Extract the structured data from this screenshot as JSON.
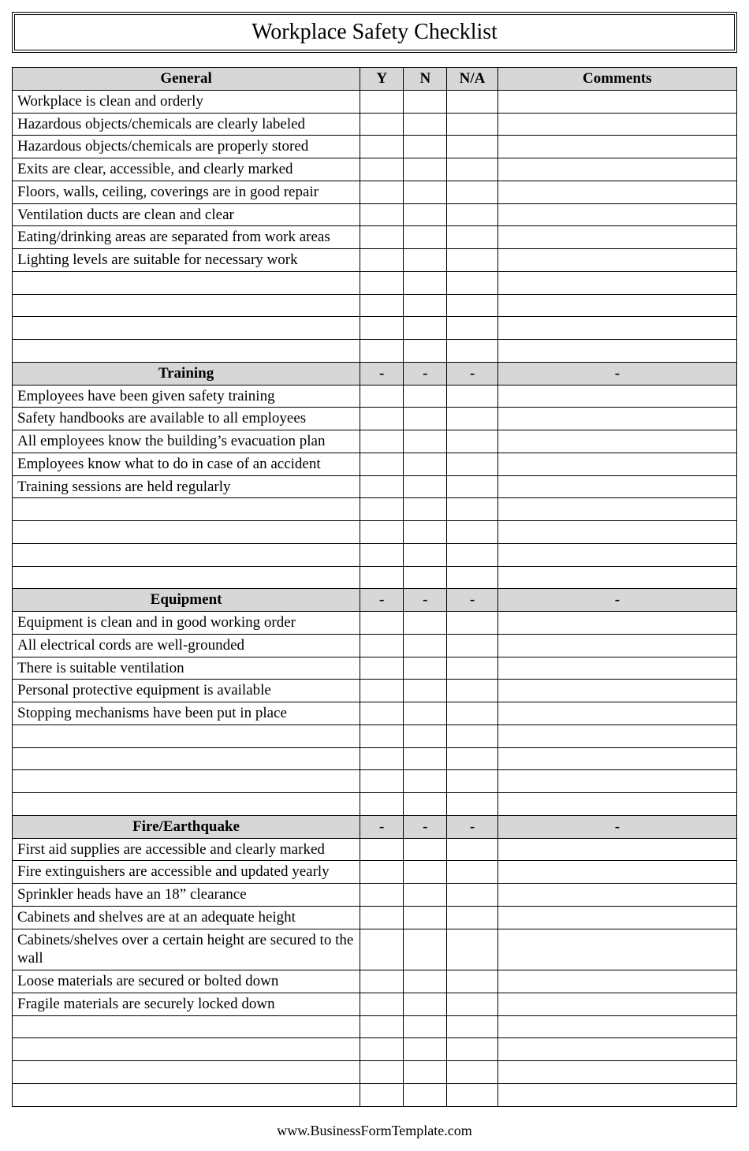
{
  "title": "Workplace Safety Checklist",
  "columns": {
    "y": "Y",
    "n": "N",
    "na": "N/A",
    "comments": "Comments"
  },
  "sections": [
    {
      "name": "General",
      "dash": false,
      "items": [
        "Workplace is clean and orderly",
        "Hazardous objects/chemicals are clearly labeled",
        "Hazardous objects/chemicals are properly stored",
        "Exits are clear, accessible, and clearly marked",
        "Floors, walls, ceiling, coverings are in good repair",
        "Ventilation ducts are clean and clear",
        "Eating/drinking areas are separated from work areas",
        "Lighting levels are suitable for necessary work"
      ],
      "blanks": 4
    },
    {
      "name": "Training",
      "dash": true,
      "items": [
        "Employees have been given safety training",
        "Safety handbooks are available to all employees",
        "All employees know the building’s evacuation plan",
        "Employees know what to do in case of an accident",
        "Training sessions are held regularly"
      ],
      "blanks": 4
    },
    {
      "name": "Equipment",
      "dash": true,
      "items": [
        "Equipment is clean and in good working order",
        "All electrical cords are well-grounded",
        "There is suitable ventilation",
        "Personal protective equipment is available",
        "Stopping mechanisms have been put in place"
      ],
      "blanks": 4
    },
    {
      "name": "Fire/Earthquake",
      "dash": true,
      "items": [
        "First aid supplies are accessible and clearly marked",
        "Fire extinguishers are accessible and updated yearly",
        "Sprinkler heads have an 18” clearance",
        "Cabinets and shelves are at an adequate height",
        "Cabinets/shelves over a certain height are secured to the wall",
        "Loose materials are secured or bolted down",
        "Fragile materials are securely locked down"
      ],
      "blanks": 4
    }
  ],
  "footer": "www.BusinessFormTemplate.com"
}
